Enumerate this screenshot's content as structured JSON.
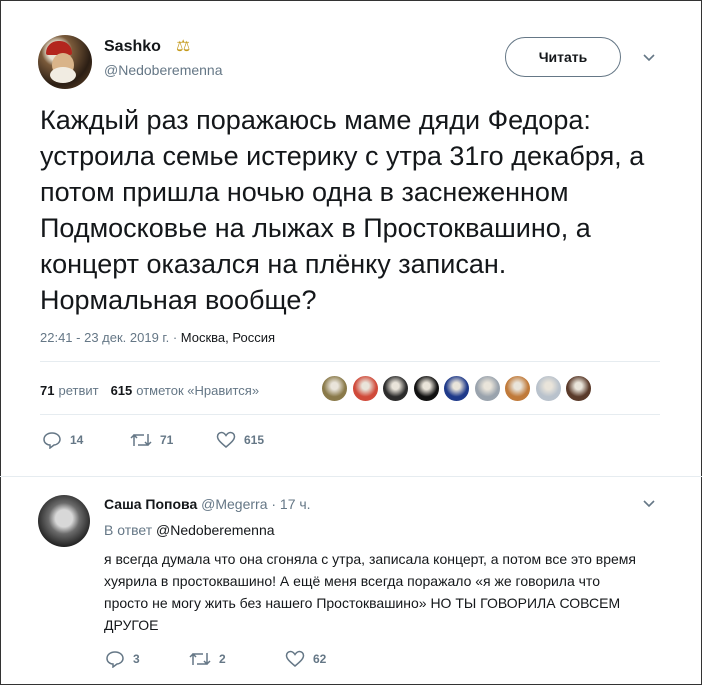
{
  "tweet": {
    "author": {
      "name": "Sashko",
      "badge": "⚖",
      "handle": "@Nedoberemenna"
    },
    "follow_label": "Читать",
    "text": "Каждый раз поражаюсь маме дяди Федора: устроила семье истерику с утра 31го декабря, а потом пришла ночью одна в заснеженном Подмосковье на лыжах в Простоквашино, а концерт оказался на плёнку записан. Нормальная вообще?",
    "timestamp": "22:41 - 23 дек. 2019 г.",
    "location": "Москва, Россия",
    "stats": {
      "retweets_count": "71",
      "retweets_label": "ретвит",
      "likes_count": "615",
      "likes_label": "отметок «Нравится»"
    },
    "likers": [
      {
        "icon": "liker-avatar-1",
        "color": "#8a7a4a"
      },
      {
        "icon": "liker-avatar-2",
        "color": "#d04a3a"
      },
      {
        "icon": "liker-avatar-3",
        "color": "#2c2c2c"
      },
      {
        "icon": "liker-avatar-4",
        "color": "#111111"
      },
      {
        "icon": "liker-avatar-5",
        "color": "#1f3a8a"
      },
      {
        "icon": "liker-avatar-6",
        "color": "#9aa3ad"
      },
      {
        "icon": "liker-avatar-7",
        "color": "#c07a3a"
      },
      {
        "icon": "liker-avatar-8",
        "color": "#b9c2cc"
      },
      {
        "icon": "liker-avatar-9",
        "color": "#5a3a2a"
      }
    ],
    "actions": {
      "replies": "14",
      "retweets": "71",
      "likes": "615"
    }
  },
  "reply": {
    "author_name": "Саша Попова",
    "handle": "@Megerra",
    "time": "· 17 ч.",
    "in_reply_prefix": "В ответ",
    "in_reply_to": "@Nedoberemenna",
    "text": "я всегда думала что она сгоняла с утра, записала концерт, а потом все это время хуярила в простоквашино! А ещё меня всегда поражало «я же говорила что просто не могу жить без нашего Простоквашино» НО ТЫ ГОВОРИЛА СОВСЕМ ДРУГОЕ",
    "actions": {
      "replies": "3",
      "retweets": "2",
      "likes": "62"
    }
  },
  "colors": {
    "text": "#14171a",
    "secondary": "#657786",
    "divider": "#e6ecf0"
  }
}
